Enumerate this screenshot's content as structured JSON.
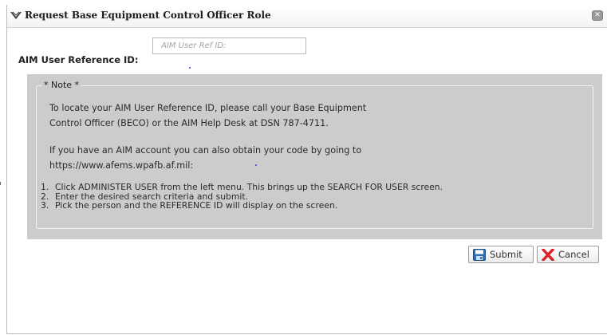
{
  "dialog": {
    "title": "Request Base Equipment Control Officer Role",
    "close_icon": "close-icon"
  },
  "form": {
    "ref_label": "AIM User Reference ID:",
    "ref_placeholder": "AIM User Ref ID:",
    "ref_value": ""
  },
  "note": {
    "legend": "* Note *",
    "para1_line1": "To locate your AIM User Reference ID, please call your Base Equipment",
    "para1_line2": "Control Officer (BECO) or the AIM Help Desk at DSN 787-4711.",
    "para2_line1": "If you have an AIM account you can also obtain your code by going to",
    "para2_line2": "https://www.afems.wpafb.af.mil:",
    "steps": [
      {
        "num": "1.",
        "text": "Click ADMINISTER USER from the left menu. This brings up the SEARCH FOR USER screen."
      },
      {
        "num": "2.",
        "text": "Enter the desired search criteria and submit."
      },
      {
        "num": "3.",
        "text": "Pick the person and the REFERENCE ID will display on the screen."
      }
    ]
  },
  "buttons": {
    "submit_label": "Submit",
    "submit_icon": "save-icon",
    "cancel_label": "Cancel",
    "cancel_icon": "x-icon"
  },
  "colors": {
    "note_background": "#cccccc",
    "submit_icon_blue": "#2f6fb3",
    "cancel_icon_red": "#d8232a"
  }
}
